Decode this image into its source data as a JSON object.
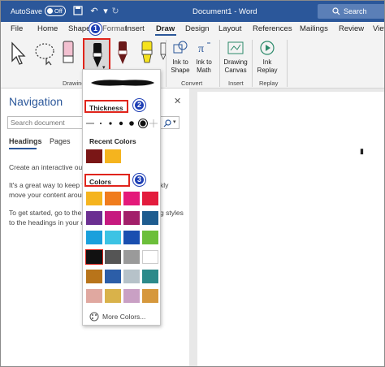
{
  "titlebar": {
    "autosave_label": "AutoSave",
    "toggle_state": "Off",
    "document_title": "Document1  -  Word",
    "search_label": "Search"
  },
  "tabs": [
    "File",
    "Home",
    "Shape",
    "Format",
    "Insert",
    "Draw",
    "Design",
    "Layout",
    "References",
    "Mailings",
    "Review",
    "View"
  ],
  "active_tab": "Draw",
  "ribbon": {
    "group_drawing": "Drawing",
    "group_convert": "Convert",
    "group_insert": "Insert",
    "group_replay": "Replay",
    "ink_to_shape": [
      "Ink to",
      "Shape"
    ],
    "ink_to_math": [
      "Ink to",
      "Math"
    ],
    "drawing_canvas": [
      "Drawing",
      "Canvas"
    ],
    "ink_replay": [
      "Ink",
      "Replay"
    ]
  },
  "navigation": {
    "title": "Navigation",
    "search_placeholder": "Search document",
    "tabs": [
      "Headings",
      "Pages"
    ],
    "text_lines": [
      "Create an interactive outli",
      "It's a great way to keep tra",
      "move your content around",
      "To get started, go to the H",
      "to the headings in your do"
    ],
    "text_right_1": "kly",
    "text_right_2": "g styles"
  },
  "dropdown": {
    "thickness_label": "Thickness",
    "recent_colors_label": "Recent Colors",
    "colors_label": "Colors",
    "more_colors_label": "More Colors...",
    "recent_colors": [
      "#7a1616",
      "#f5b41e"
    ],
    "colors": [
      [
        "#f5b41e",
        "#f07c1d",
        "#e4197a",
        "#e31c3d"
      ],
      [
        "#6b2f91",
        "#c61a7f",
        "#a2206a",
        "#1e5c8f"
      ],
      [
        "#1aa0dc",
        "#3cc3e4",
        "#1a4fb0",
        "#6cbf3a"
      ],
      [
        "#111111",
        "#555555",
        "#9a9a9a",
        "#ffffff"
      ],
      [
        "#b8741a",
        "#2c5ea8",
        "#b6c2c9",
        "#2c8a8a"
      ],
      [
        "#e0a8a0",
        "#d9b24a",
        "#c9a0c4",
        "#d6983c"
      ]
    ]
  },
  "badges": [
    "1",
    "2",
    "3"
  ],
  "accent_color": "#2b579a",
  "highlight_color": "#e0241b"
}
